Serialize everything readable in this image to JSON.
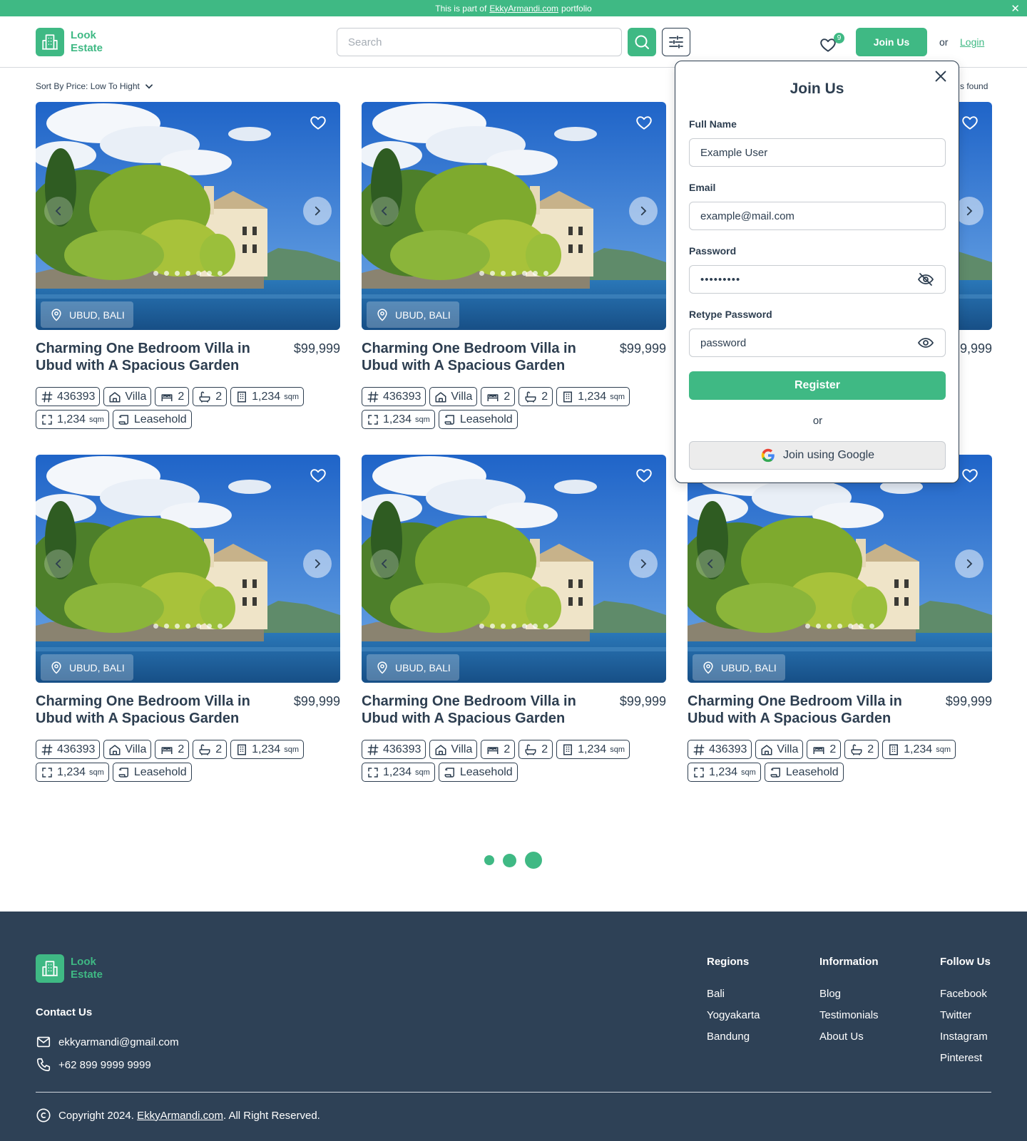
{
  "banner": {
    "prefix": "This is part of",
    "link": "EkkyArmandi.com",
    "suffix": "portfolio"
  },
  "brand": {
    "line1": "Look",
    "line2": "Estate"
  },
  "search": {
    "placeholder": "Search"
  },
  "header": {
    "fav_count": "9",
    "join_label": "Join Us",
    "or_label": "or",
    "login_label": "Login"
  },
  "sort": {
    "label": "Sort By Price: Low To Hight"
  },
  "results": {
    "found_text": "s found"
  },
  "listing": {
    "location": "UBUD, BALI",
    "title": "Charming One Bedroom Villa in Ubud with A Spacious Garden",
    "price": "$99,999",
    "id": "436393",
    "type": "Villa",
    "beds": "2",
    "baths": "2",
    "building_area": "1,234",
    "land_area": "1,234",
    "area_unit": "sqm",
    "ownership": "Leasehold"
  },
  "modal": {
    "title": "Join Us",
    "full_name_label": "Full Name",
    "full_name_value": "Example User",
    "email_label": "Email",
    "email_value": "example@mail.com",
    "password_label": "Password",
    "password_value": "•••••••••",
    "retype_label": "Retype Password",
    "retype_placeholder": "password",
    "register_label": "Register",
    "or_label": "or",
    "google_label": "Join using Google"
  },
  "footer": {
    "contact_heading": "Contact Us",
    "email": "ekkyarmandi@gmail.com",
    "phone": "+62 899 9999 9999",
    "regions": {
      "heading": "Regions",
      "items": [
        "Bali",
        "Yogyakarta",
        "Bandung"
      ]
    },
    "information": {
      "heading": "Information",
      "items": [
        "Blog",
        "Testimonials",
        "About Us"
      ]
    },
    "follow": {
      "heading": "Follow Us",
      "items": [
        "Facebook",
        "Twitter",
        "Instagram",
        "Pinterest"
      ]
    },
    "copyright_prefix": "Copyright 2024.",
    "copyright_link": "EkkyArmandi.com",
    "copyright_suffix": ". All Right Reserved."
  },
  "colors": {
    "accent": "#3fb984",
    "dark": "#2e4156"
  },
  "icons": [
    "close-icon",
    "building-icon",
    "search-icon",
    "sliders-icon",
    "heart-icon",
    "chevron-down-icon",
    "chevron-left-icon",
    "chevron-right-icon",
    "map-pin-icon",
    "hash-icon",
    "home-icon",
    "bed-icon",
    "bath-icon",
    "building-area-icon",
    "land-area-icon",
    "scroll-icon",
    "eye-off-icon",
    "eye-icon",
    "google-icon",
    "mail-icon",
    "phone-icon",
    "copyright-icon"
  ]
}
